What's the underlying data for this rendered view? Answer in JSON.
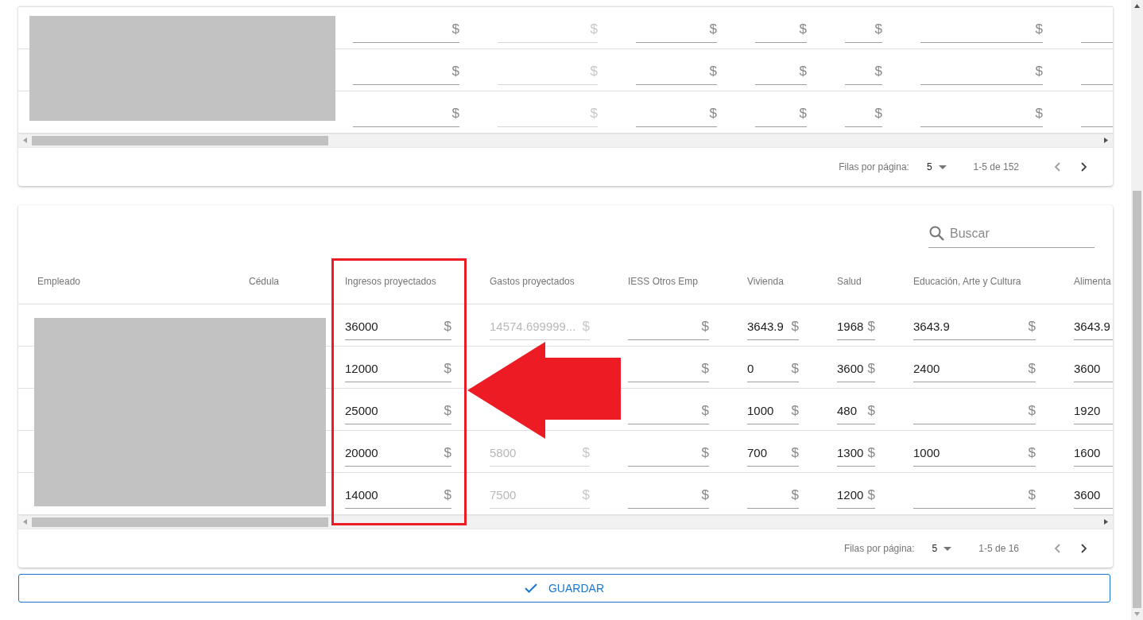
{
  "top_table": {
    "redacted": true,
    "rows": [
      {
        "cells": [
          "",
          "",
          {
            "suffix": "$",
            "disabled": false
          },
          {
            "suffix": "$",
            "disabled": true
          },
          {
            "suffix": "$",
            "disabled": false
          },
          {
            "suffix": "$",
            "disabled": false
          },
          {
            "suffix": "$",
            "disabled": false
          },
          {
            "suffix": "$",
            "disabled": false
          },
          {
            "disabled": false
          }
        ]
      },
      {
        "cells": [
          "",
          "",
          {
            "suffix": "$",
            "disabled": false
          },
          {
            "suffix": "$",
            "disabled": true
          },
          {
            "suffix": "$",
            "disabled": false
          },
          {
            "suffix": "$",
            "disabled": false
          },
          {
            "suffix": "$",
            "disabled": false
          },
          {
            "suffix": "$",
            "disabled": false
          },
          {
            "disabled": false
          }
        ]
      },
      {
        "cells": [
          "",
          "",
          {
            "suffix": "$",
            "disabled": false
          },
          {
            "suffix": "$",
            "disabled": true
          },
          {
            "suffix": "$",
            "disabled": false
          },
          {
            "suffix": "$",
            "disabled": false
          },
          {
            "suffix": "$",
            "disabled": false
          },
          {
            "suffix": "$",
            "disabled": false
          },
          {
            "disabled": false
          }
        ]
      }
    ],
    "pagination": {
      "label": "Filas por página:",
      "per_page": "5",
      "range": "1-5 de 152",
      "prev_disabled": true,
      "next_disabled": false
    }
  },
  "bottom_table": {
    "redacted": true,
    "search": {
      "placeholder": "Buscar"
    },
    "columns": [
      "Empleado",
      "Cédula",
      "Ingresos proyectados",
      "Gastos proyectados",
      "IESS Otros Emp",
      "Vivienda",
      "Salud",
      "Educación, Arte y Cultura",
      "Alimenta"
    ],
    "rows": [
      {
        "cells": [
          "",
          "",
          {
            "value": "36000",
            "suffix": "$",
            "disabled": false
          },
          {
            "value": "14574.699999...",
            "suffix": "$",
            "disabled": true
          },
          {
            "suffix": "$",
            "disabled": false
          },
          {
            "value": "3643.9",
            "suffix": "$",
            "disabled": false
          },
          {
            "value": "1968",
            "suffix": "$",
            "disabled": false
          },
          {
            "value": "3643.9",
            "suffix": "$",
            "disabled": false
          },
          {
            "value": "3643.9",
            "disabled": false
          }
        ]
      },
      {
        "cells": [
          "",
          "",
          {
            "value": "12000",
            "suffix": "$",
            "disabled": false
          },
          "",
          {
            "suffix": "$",
            "disabled": false
          },
          {
            "value": "0",
            "suffix": "$",
            "disabled": false
          },
          {
            "value": "3600",
            "suffix": "$",
            "disabled": false
          },
          {
            "value": "2400",
            "suffix": "$",
            "disabled": false
          },
          {
            "value": "3600",
            "disabled": false
          }
        ]
      },
      {
        "cells": [
          "",
          "",
          {
            "value": "25000",
            "suffix": "$",
            "disabled": false
          },
          "",
          {
            "suffix": "$",
            "disabled": false
          },
          {
            "value": "1000",
            "suffix": "$",
            "disabled": false
          },
          {
            "value": "480",
            "suffix": "$",
            "disabled": false
          },
          {
            "suffix": "$",
            "disabled": false
          },
          {
            "value": "1920",
            "disabled": false
          }
        ]
      },
      {
        "cells": [
          "",
          "",
          {
            "value": "20000",
            "suffix": "$",
            "disabled": false
          },
          {
            "value": "5800",
            "suffix": "$",
            "disabled": true
          },
          {
            "suffix": "$",
            "disabled": false
          },
          {
            "value": "700",
            "suffix": "$",
            "disabled": false
          },
          {
            "value": "1300",
            "suffix": "$",
            "disabled": false
          },
          {
            "value": "1000",
            "suffix": "$",
            "disabled": false
          },
          {
            "value": "1600",
            "disabled": false
          }
        ]
      },
      {
        "cells": [
          "",
          "",
          {
            "value": "14000",
            "suffix": "$",
            "disabled": false
          },
          {
            "value": "7500",
            "suffix": "$",
            "disabled": true
          },
          {
            "suffix": "$",
            "disabled": false
          },
          {
            "suffix": "$",
            "disabled": false
          },
          {
            "value": "1200",
            "suffix": "$",
            "disabled": false
          },
          {
            "suffix": "$",
            "disabled": false
          },
          {
            "value": "3600",
            "disabled": false
          }
        ]
      }
    ],
    "pagination": {
      "label": "Filas por página:",
      "per_page": "5",
      "range": "1-5 de 16",
      "prev_disabled": true,
      "next_disabled": false
    }
  },
  "annotation": {
    "highlight_frame": true,
    "arrow": true
  },
  "save_button": {
    "label": "GUARDAR"
  }
}
